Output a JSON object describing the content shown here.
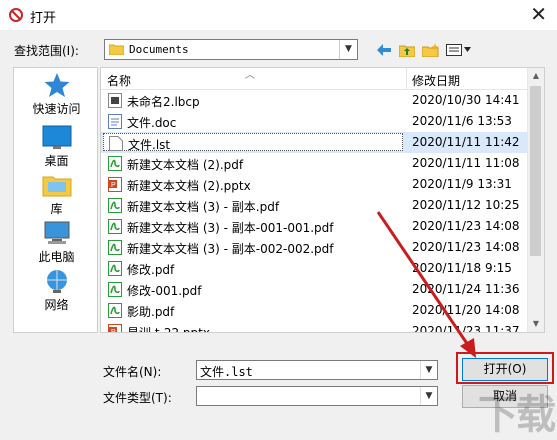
{
  "window": {
    "title": "打开",
    "close_glyph": "✕"
  },
  "lookin": {
    "label": "查找范围(I):",
    "value": "Documents"
  },
  "toolbar": {
    "icons": [
      "back-arrow-icon",
      "up-folder-icon",
      "new-folder-icon",
      "view-menu-icon"
    ]
  },
  "places": [
    {
      "label": "快速访问",
      "icon": "star-icon"
    },
    {
      "label": "桌面",
      "icon": "desktop-icon"
    },
    {
      "label": "库",
      "icon": "library-icon"
    },
    {
      "label": "此电脑",
      "icon": "computer-icon"
    },
    {
      "label": "网络",
      "icon": "network-icon"
    }
  ],
  "file_list": {
    "columns": {
      "name": "名称",
      "date": "修改日期"
    },
    "rows": [
      {
        "name": "未命名2.lbcp",
        "date": "2020/10/30 14:41",
        "type": "lbcp"
      },
      {
        "name": "文件.doc",
        "date": "2020/11/6 13:53",
        "type": "doc"
      },
      {
        "name": "文件.lst",
        "date": "2020/11/11 11:42",
        "type": "lst",
        "selected": true
      },
      {
        "name": "新建文本文档 (2).pdf",
        "date": "2020/11/11 11:08",
        "type": "pdf"
      },
      {
        "name": "新建文本文档 (2).pptx",
        "date": "2020/11/9 13:31",
        "type": "pptx"
      },
      {
        "name": "新建文本文档 (3) - 副本.pdf",
        "date": "2020/11/12 10:25",
        "type": "pdf"
      },
      {
        "name": "新建文本文档 (3) - 副本-001-001.pdf",
        "date": "2020/11/23 14:08",
        "type": "pdf"
      },
      {
        "name": "新建文本文档 (3) - 副本-002-002.pdf",
        "date": "2020/11/23 14:08",
        "type": "pdf"
      },
      {
        "name": "修改.pdf",
        "date": "2020/11/18 9:15",
        "type": "pdf"
      },
      {
        "name": "修改-001.pdf",
        "date": "2020/11/24 11:36",
        "type": "pdf"
      },
      {
        "name": "影助.pdf",
        "date": "2020/11/20 14:08",
        "type": "pdf"
      },
      {
        "name": "易训.t-22.pptx",
        "date": "2020/11/23 11:37",
        "type": "pptx"
      }
    ]
  },
  "filename": {
    "label": "文件名(N):",
    "value": "文件.lst"
  },
  "filetype": {
    "label": "文件类型(T):",
    "value": ""
  },
  "buttons": {
    "open": "打开(O)",
    "cancel": "取消"
  },
  "colors": {
    "pdf_green": "#2a9d3b",
    "pptx_orange": "#d04a1f",
    "highlight_red": "#d0191a",
    "selection": "#d9e8fb"
  }
}
